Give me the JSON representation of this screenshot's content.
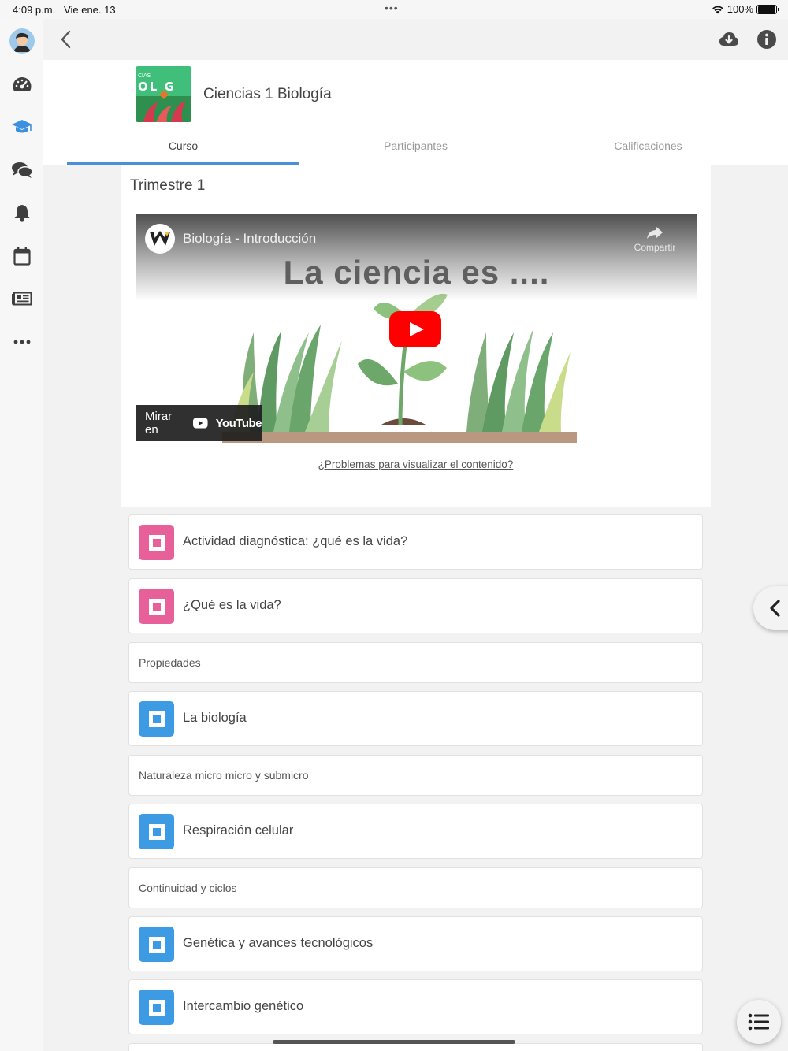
{
  "status_bar": {
    "time": "4:09 p.m.",
    "date": "Vie ene. 13",
    "battery": "100%",
    "battery_level": 1.0
  },
  "sidebar": {
    "items": [
      {
        "name": "avatar",
        "icon": "user-avatar"
      },
      {
        "name": "dashboard",
        "icon": "speedometer-icon"
      },
      {
        "name": "courses",
        "icon": "graduation-cap-icon",
        "active": true
      },
      {
        "name": "messages",
        "icon": "chat-bubbles-icon"
      },
      {
        "name": "notifications",
        "icon": "bell-icon"
      },
      {
        "name": "calendar",
        "icon": "calendar-icon"
      },
      {
        "name": "news",
        "icon": "newspaper-icon"
      },
      {
        "name": "more",
        "icon": "ellipsis-icon"
      }
    ]
  },
  "topbar": {
    "back_icon": "chevron-left-icon",
    "download_icon": "cloud-download-icon",
    "info_icon": "info-icon"
  },
  "course": {
    "title": "Ciencias 1 Biología",
    "thumb_text_small": "CIAS",
    "thumb_text": "OL G",
    "tabs": [
      {
        "label": "Curso",
        "active": true
      },
      {
        "label": "Participantes",
        "active": false
      },
      {
        "label": "Calificaciones",
        "active": false
      }
    ]
  },
  "section": {
    "title": "Trimestre 1",
    "video": {
      "title": "Biología - Introducción",
      "share_label": "Compartir",
      "overlay_text": "La ciencia es ....",
      "watch_on": "Mirar en",
      "youtube": "YouTube"
    },
    "problem_link": "¿Problemas para visualizar el contenido?"
  },
  "items": [
    {
      "type": "activity",
      "title": "Actividad diagnóstica: ¿qué es la vida?",
      "color": "#e8609a"
    },
    {
      "type": "activity",
      "title": "¿Qué es la vida?",
      "color": "#e8609a"
    },
    {
      "type": "label",
      "title": "Propiedades"
    },
    {
      "type": "activity",
      "title": "La biología",
      "color": "#3d9be4"
    },
    {
      "type": "label",
      "title": "Naturaleza micro micro y submicro"
    },
    {
      "type": "activity",
      "title": "Respiración celular",
      "color": "#3d9be4"
    },
    {
      "type": "label",
      "title": "Continuidad y ciclos"
    },
    {
      "type": "activity",
      "title": "Genética y avances tecnológicos",
      "color": "#3d9be4"
    },
    {
      "type": "activity",
      "title": "Intercambio genético",
      "color": "#3d9be4"
    }
  ],
  "colors": {
    "accent": "#4a90d9",
    "pink": "#e8609a",
    "blue": "#3d9be4",
    "youtube_red": "#ff0000"
  }
}
